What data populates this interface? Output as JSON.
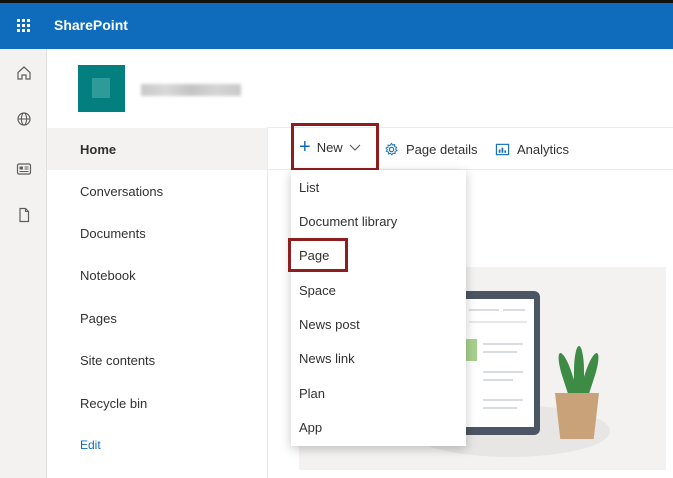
{
  "suite": {
    "brand": "SharePoint"
  },
  "rail": [
    "home-icon",
    "globe-icon",
    "news-icon",
    "document-icon"
  ],
  "nav": {
    "items": [
      {
        "label": "Home"
      },
      {
        "label": "Conversations"
      },
      {
        "label": "Documents"
      },
      {
        "label": "Notebook"
      },
      {
        "label": "Pages"
      },
      {
        "label": "Site contents"
      },
      {
        "label": "Recycle bin"
      },
      {
        "label": "Edit"
      }
    ]
  },
  "commandbar": {
    "new_label": "New",
    "page_details_label": "Page details",
    "analytics_label": "Analytics"
  },
  "new_menu": {
    "items": [
      {
        "label": "List"
      },
      {
        "label": "Document library"
      },
      {
        "label": "Page"
      },
      {
        "label": "Space"
      },
      {
        "label": "News post"
      },
      {
        "label": "News link"
      },
      {
        "label": "Plan"
      },
      {
        "label": "App"
      }
    ]
  },
  "colors": {
    "suite_bar": "#0f6cbd",
    "highlight_border": "#8e1d1d",
    "site_logo": "#037f7f"
  }
}
